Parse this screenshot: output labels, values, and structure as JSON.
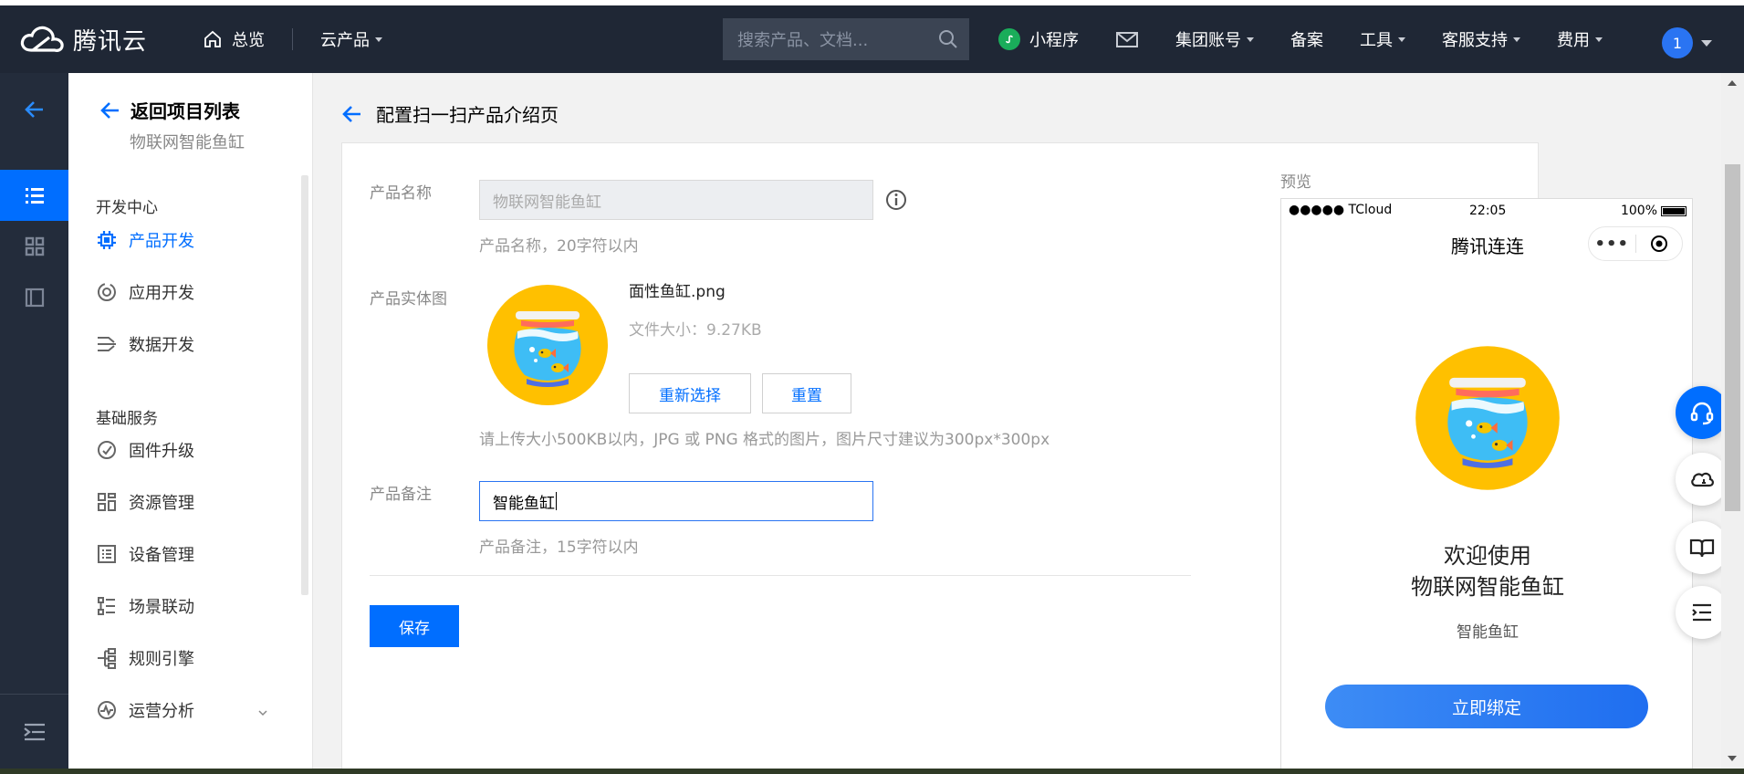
{
  "header": {
    "brand": "腾讯云",
    "home": "总览",
    "products": "云产品",
    "search_placeholder": "搜索产品、文档...",
    "nav": [
      "小程序",
      "集团账号",
      "备案",
      "工具",
      "客服支持",
      "费用"
    ],
    "avatar": "1"
  },
  "sidebar": {
    "back_label": "返回项目列表",
    "project_name": "物联网智能鱼缸",
    "group_dev": "开发中心",
    "dev_items": [
      "产品开发",
      "应用开发",
      "数据开发"
    ],
    "group_basic": "基础服务",
    "basic_items": [
      "固件升级",
      "资源管理",
      "设备管理",
      "场景联动",
      "规则引擎",
      "运营分析"
    ]
  },
  "page": {
    "title": "配置扫一扫产品介绍页",
    "name_label": "产品名称",
    "name_value": "物联网智能鱼缸",
    "name_hint": "产品名称，20字符以内",
    "image_label": "产品实体图",
    "file_name": "面性鱼缸.png",
    "file_size": "文件大小：9.27KB",
    "reselect": "重新选择",
    "reset": "重置",
    "image_hint": "请上传大小500KB以内，JPG 或 PNG 格式的图片，图片尺寸建议为300px*300px",
    "note_label": "产品备注",
    "note_value": "智能鱼缸",
    "note_hint": "产品备注，15字符以内",
    "save": "保存"
  },
  "preview": {
    "label": "预览",
    "carrier": "●●●●● TCloud",
    "time": "22:05",
    "battery": "100%",
    "app_title": "腾讯连连",
    "capsule_dots": "•••",
    "welcome_line1": "欢迎使用",
    "welcome_line2": "物联网智能鱼缸",
    "subtitle": "智能鱼缸",
    "bind_button": "立即绑定"
  },
  "colors": {
    "primary": "#006eff",
    "topbar": "#1f2735",
    "rail": "#232c3b"
  }
}
